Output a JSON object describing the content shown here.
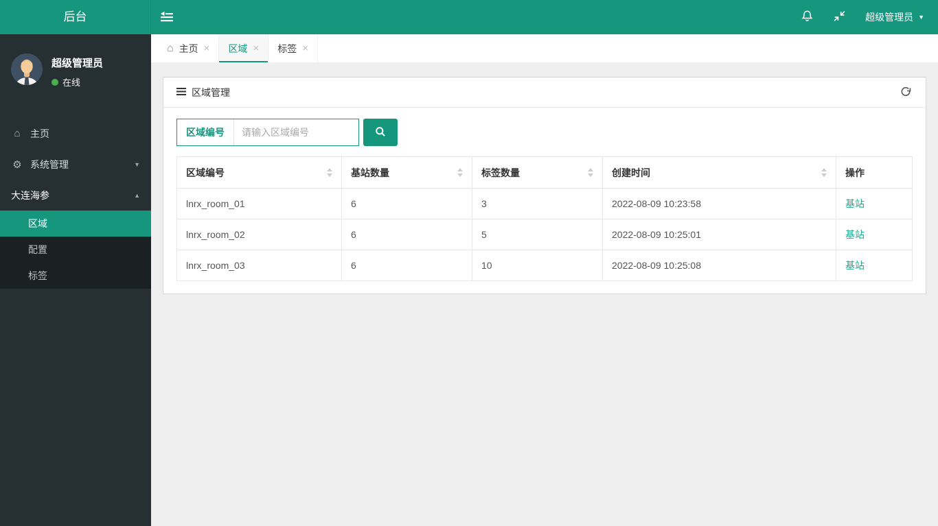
{
  "header": {
    "logo": "后台",
    "username": "超级管理员"
  },
  "sidebar": {
    "user": {
      "name": "超级管理员",
      "status": "在线"
    },
    "items": [
      {
        "icon": "home-icon",
        "label": "主页"
      },
      {
        "icon": "gear-icon",
        "label": "系统管理",
        "caret": "down"
      },
      {
        "icon": null,
        "label": "大连海参",
        "caret": "up"
      }
    ],
    "submenu": [
      {
        "label": "区域",
        "active": true
      },
      {
        "label": "配置",
        "active": false
      },
      {
        "label": "标签",
        "active": false
      }
    ]
  },
  "tabs": [
    {
      "label": "主页",
      "icon": "home-icon",
      "active": false
    },
    {
      "label": "区域",
      "icon": null,
      "active": true
    },
    {
      "label": "标签",
      "icon": null,
      "active": false
    }
  ],
  "panel": {
    "title": "区域管理",
    "search_label": "区域编号",
    "search_placeholder": "请输入区域编号",
    "search_value": ""
  },
  "table": {
    "columns": [
      "区域编号",
      "基站数量",
      "标签数量",
      "创建时间",
      "操作"
    ],
    "sortable_columns": [
      true,
      true,
      true,
      true,
      false
    ],
    "rows": [
      {
        "region_id": "lnrx_room_01",
        "base_stations": 6,
        "tag_count": 3,
        "created_at": "2022-08-09 10:23:58",
        "action": "基站"
      },
      {
        "region_id": "lnrx_room_02",
        "base_stations": 6,
        "tag_count": 5,
        "created_at": "2022-08-09 10:25:01",
        "action": "基站"
      },
      {
        "region_id": "lnrx_room_03",
        "base_stations": 6,
        "tag_count": 10,
        "created_at": "2022-08-09 10:25:08",
        "action": "基站"
      }
    ]
  },
  "icons": {
    "menu_toggle": "outdent-lines",
    "notifications": "bell",
    "fullscreen_exit": "compress-arrows",
    "user_caret": "caret-down",
    "panel_title_icon": "list-bars",
    "refresh": "rotate-arrow",
    "search": "magnifier",
    "sort": "caret-up-down",
    "tab_close": "x-cross",
    "status": "green-dot"
  },
  "colors": {
    "accent": "#17967E",
    "sidebar_bg": "#262F31",
    "submenu_bg": "#1A2123",
    "content_bg": "#EFEFEF",
    "panel_border": "#D9D9D9",
    "table_border": "#E7E7E7",
    "link": "#1BA98E",
    "status_green": "#4CAE4C",
    "tab_active_bg": "#F7F7F7"
  }
}
